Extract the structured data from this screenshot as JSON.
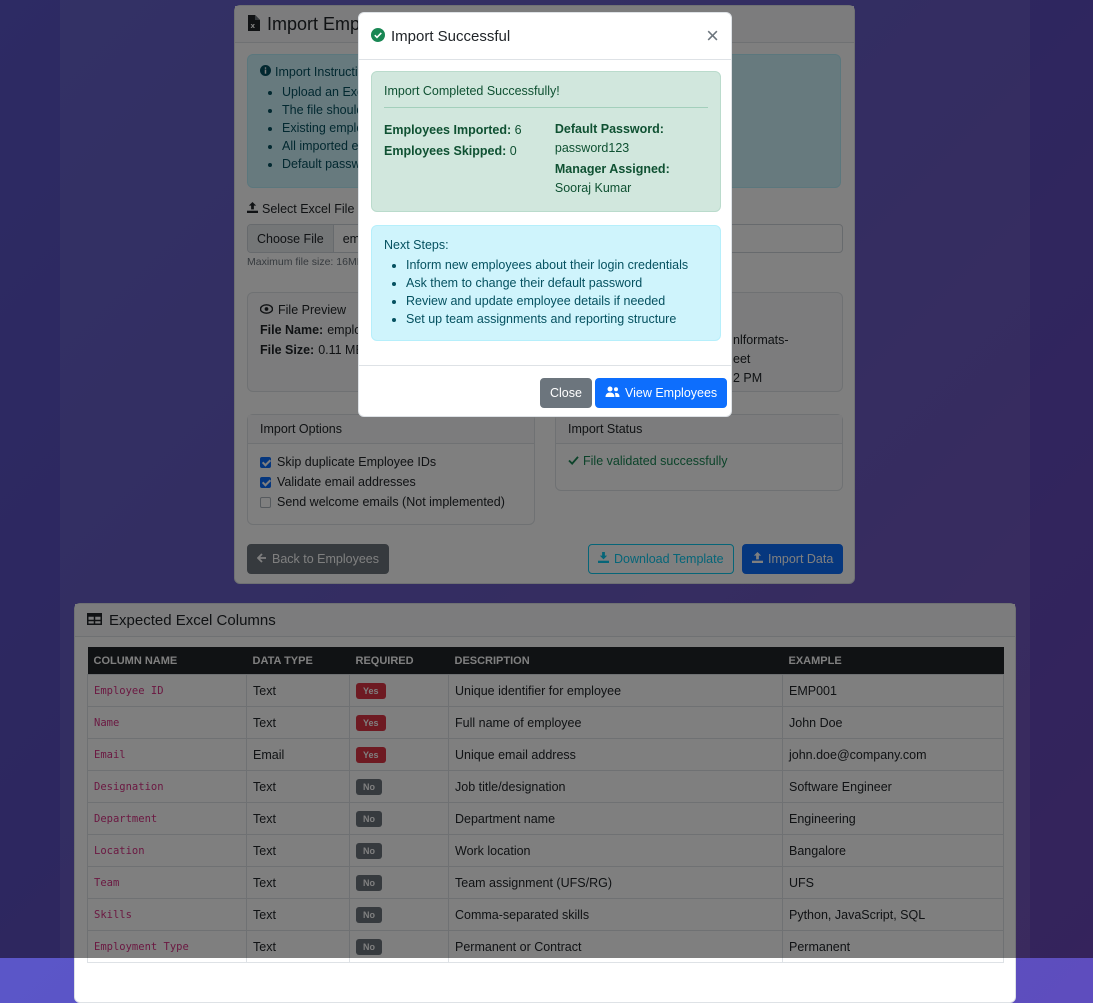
{
  "import_card": {
    "title": "Import Employees",
    "instructions": {
      "title": "Import Instructions",
      "items": [
        "Upload an Excel file (.xlsx or .xls)",
        "The file should contain employee data with headers",
        "Existing employees will be skipped",
        "All imported employees will be assigned to you",
        "Default password: password123"
      ]
    },
    "file_label": "Select Excel File",
    "choose_file": "Choose File",
    "file_name_display": "employees.xlsx",
    "max_size": "Maximum file size: 16MB",
    "preview": {
      "title": "File Preview",
      "file_name_label": "File Name:",
      "file_name_value": "employees.xlsx",
      "file_size_label": "File Size:",
      "file_size_value": "0.11 MB",
      "file_type_fragment_1": "nlformats-",
      "file_type_fragment_2": "eet",
      "modified_fragment": "2 PM"
    },
    "options": {
      "title": "Import Options",
      "items": [
        {
          "label": "Skip duplicate Employee IDs",
          "checked": true
        },
        {
          "label": "Validate email addresses",
          "checked": true
        },
        {
          "label": "Send welcome emails (Not implemented)",
          "checked": false
        }
      ]
    },
    "status": {
      "title": "Import Status",
      "message": "File validated successfully"
    },
    "back_button": "Back to Employees",
    "download_button": "Download Template",
    "import_button": "Import Data"
  },
  "columns_card": {
    "title": "Expected Excel Columns",
    "headers": [
      "COLUMN NAME",
      "DATA TYPE",
      "REQUIRED",
      "DESCRIPTION",
      "EXAMPLE"
    ],
    "rows": [
      {
        "name": "Employee ID",
        "type": "Text",
        "required": "Yes",
        "description": "Unique identifier for employee",
        "example": "EMP001"
      },
      {
        "name": "Name",
        "type": "Text",
        "required": "Yes",
        "description": "Full name of employee",
        "example": "John Doe"
      },
      {
        "name": "Email",
        "type": "Email",
        "required": "Yes",
        "description": "Unique email address",
        "example": "john.doe@company.com"
      },
      {
        "name": "Designation",
        "type": "Text",
        "required": "No",
        "description": "Job title/designation",
        "example": "Software Engineer"
      },
      {
        "name": "Department",
        "type": "Text",
        "required": "No",
        "description": "Department name",
        "example": "Engineering"
      },
      {
        "name": "Location",
        "type": "Text",
        "required": "No",
        "description": "Work location",
        "example": "Bangalore"
      },
      {
        "name": "Team",
        "type": "Text",
        "required": "No",
        "description": "Team assignment (UFS/RG)",
        "example": "UFS"
      },
      {
        "name": "Skills",
        "type": "Text",
        "required": "No",
        "description": "Comma-separated skills",
        "example": "Python, JavaScript, SQL"
      },
      {
        "name": "Employment Type",
        "type": "Text",
        "required": "No",
        "description": "Permanent or Contract",
        "example": "Permanent"
      }
    ]
  },
  "modal": {
    "title": "Import Successful",
    "success_heading": "Import Completed Successfully!",
    "imported_label": "Employees Imported:",
    "imported_value": "6",
    "skipped_label": "Employees Skipped:",
    "skipped_value": "0",
    "password_label": "Default Password:",
    "password_value": "password123",
    "manager_label": "Manager Assigned:",
    "manager_value": "Sooraj Kumar",
    "next_steps_title": "Next Steps:",
    "next_steps": [
      "Inform new employees about their login credentials",
      "Ask them to change their default password",
      "Review and update employee details if needed",
      "Set up team assignments and reporting structure"
    ],
    "close_button": "Close",
    "view_button": "View Employees"
  },
  "colors": {
    "primary": "#0d6efd",
    "success": "#198754",
    "danger": "#dc3545",
    "secondary": "#6c757d",
    "info": "#0dcaf0"
  }
}
